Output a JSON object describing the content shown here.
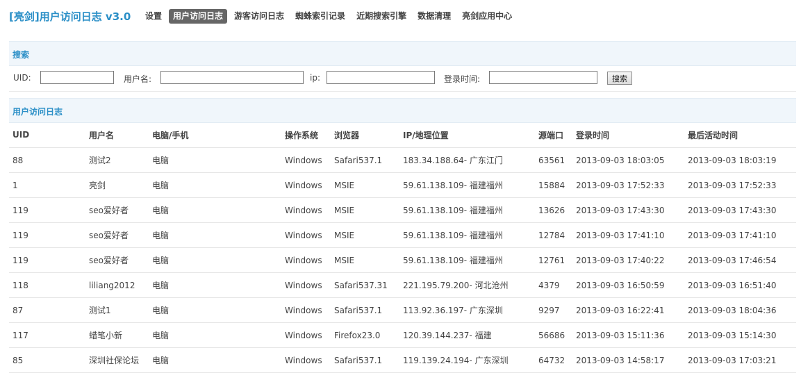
{
  "header": {
    "title": "[亮剑]用户访问日志 v3.0",
    "nav": [
      {
        "label": "设置",
        "active": false
      },
      {
        "label": "用户访问日志",
        "active": true
      },
      {
        "label": "游客访问日志",
        "active": false
      },
      {
        "label": "蜘蛛索引记录",
        "active": false
      },
      {
        "label": "近期搜索引擎",
        "active": false
      },
      {
        "label": "数据清理",
        "active": false
      },
      {
        "label": "亮剑应用中心",
        "active": false
      }
    ]
  },
  "search": {
    "title": "搜索",
    "uid_label": "UID:",
    "uid_value": "",
    "username_label": "用户名:",
    "username_value": "",
    "ip_label": "ip:",
    "ip_value": "",
    "login_time_label": "登录时间:",
    "login_time_value": "",
    "button_label": "搜索"
  },
  "log": {
    "title": "用户访问日志",
    "columns": [
      "UID",
      "用户名",
      "电脑/手机",
      "操作系统",
      "浏览器",
      "IP/地理位置",
      "源端口",
      "登录时间",
      "最后活动时间"
    ],
    "rows": [
      [
        "88",
        "测试2",
        "电脑",
        "Windows",
        "Safari537.1",
        "183.34.188.64- 广东江门",
        "63561",
        "2013-09-03 18:03:05",
        "2013-09-03 18:03:19"
      ],
      [
        "1",
        "亮剑",
        "电脑",
        "Windows",
        "MSIE",
        "59.61.138.109- 福建福州",
        "15884",
        "2013-09-03 17:52:33",
        "2013-09-03 17:52:33"
      ],
      [
        "119",
        "seo爱好者",
        "电脑",
        "Windows",
        "MSIE",
        "59.61.138.109- 福建福州",
        "13626",
        "2013-09-03 17:43:30",
        "2013-09-03 17:43:30"
      ],
      [
        "119",
        "seo爱好者",
        "电脑",
        "Windows",
        "MSIE",
        "59.61.138.109- 福建福州",
        "12784",
        "2013-09-03 17:41:10",
        "2013-09-03 17:41:10"
      ],
      [
        "119",
        "seo爱好者",
        "电脑",
        "Windows",
        "MSIE",
        "59.61.138.109- 福建福州",
        "12761",
        "2013-09-03 17:40:22",
        "2013-09-03 17:46:54"
      ],
      [
        "118",
        "liliang2012",
        "电脑",
        "Windows",
        "Safari537.31",
        "221.195.79.200- 河北沧州",
        "4379",
        "2013-09-03 16:50:59",
        "2013-09-03 16:51:40"
      ],
      [
        "87",
        "测试1",
        "电脑",
        "Windows",
        "Safari537.1",
        "113.92.36.197- 广东深圳",
        "9297",
        "2013-09-03 16:22:41",
        "2013-09-03 18:04:36"
      ],
      [
        "117",
        "蜡笔小新",
        "电脑",
        "Windows",
        "Firefox23.0",
        "120.39.144.237- 福建",
        "56686",
        "2013-09-03 15:11:36",
        "2013-09-03 15:14:30"
      ],
      [
        "85",
        "深圳社保论坛",
        "电脑",
        "Windows",
        "Safari537.1",
        "119.139.24.194- 广东深圳",
        "64732",
        "2013-09-03 14:58:17",
        "2013-09-03 17:03:21"
      ]
    ]
  }
}
